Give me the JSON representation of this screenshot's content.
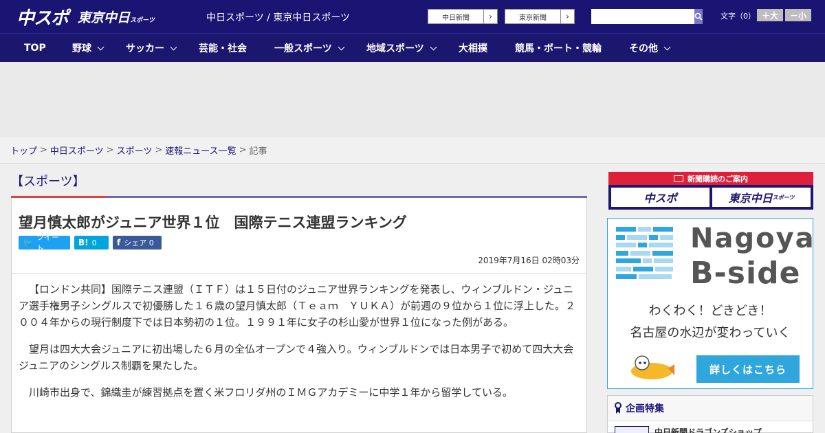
{
  "header": {
    "logo_main": "中スポ",
    "logo_tokyo": "東京中日",
    "logo_tokyo_sub": "スポーツ",
    "site_title": "中日スポーツ / 東京中日スポーツ",
    "ext_links": [
      "中日新聞",
      "東京新聞"
    ],
    "search_placeholder": "",
    "font_size_label": "文字（0）",
    "font_larger": "＋大",
    "font_smaller": "－小"
  },
  "nav": {
    "items": [
      {
        "label": "TOP",
        "dropdown": false
      },
      {
        "label": "野球",
        "dropdown": true
      },
      {
        "label": "サッカー",
        "dropdown": true
      },
      {
        "label": "芸能・社会",
        "dropdown": false
      },
      {
        "label": "一般スポーツ",
        "dropdown": true
      },
      {
        "label": "地域スポーツ",
        "dropdown": true
      },
      {
        "label": "大相撲",
        "dropdown": false
      },
      {
        "label": "競馬・ボート・競輪",
        "dropdown": false
      },
      {
        "label": "その他",
        "dropdown": true
      }
    ]
  },
  "breadcrumb": {
    "items": [
      "トップ",
      "中日スポーツ",
      "スポーツ",
      "速報ニュース一覧"
    ],
    "current": "記事"
  },
  "article": {
    "category": "【スポーツ】",
    "headline": "望月慎太郎がジュニア世界１位　国際テニス連盟ランキング",
    "share": {
      "tweet": "ツイート",
      "hatena": "0",
      "facebook": "シェア 0"
    },
    "date": "2019年7月16日 02時03分",
    "paragraphs": [
      "【ロンドン共同】国際テニス連盟（ＩＴＦ）は１５日付のジュニア世界ランキングを発表し、ウィンブルドン・ジュニア選手権男子シングルスで初優勝した１６歳の望月慎太郎（Ｔｅａｍ　ＹＵＫＡ）が前週の９位から１位に浮上した。２００４年からの現行制度下では日本勢初の１位。１９９１年に女子の杉山愛が世界１位になった例がある。",
      "望月は四大大会ジュニアに初出場した６月の全仏オープンで４強入り。ウィンブルドンでは日本男子で初めて四大大会ジュニアのシングルス制覇を果たした。",
      "川崎市出身で、錦織圭が練習拠点を置く米フロリダ州のＩＭＧアカデミーに中学１年から留学している。"
    ]
  },
  "sidebar": {
    "subscribe": {
      "title": "新聞購読のご案内",
      "left": "中スポ",
      "right": "東京中日",
      "right_sub": "スポーツ"
    },
    "bside": {
      "title1": "Nagoya",
      "title2": "B-side",
      "line1": "わくわく！どきどき！",
      "line2": "名古屋の水辺が変わっていく",
      "cta": "詳しくはこちら"
    },
    "kikaku": {
      "title": "企画特集",
      "item": "中日新聞ドラゴンズショップ"
    }
  },
  "colors": {
    "header_bg": "#1a1573",
    "nav_bg": "#1c176e",
    "accent_red": "#e63d3d",
    "accent_purple": "#6f6ab7",
    "twitter": "#1da1f2",
    "hatena": "#00a4de",
    "facebook": "#3b5998",
    "bside_blue": "#2fa6dc"
  }
}
